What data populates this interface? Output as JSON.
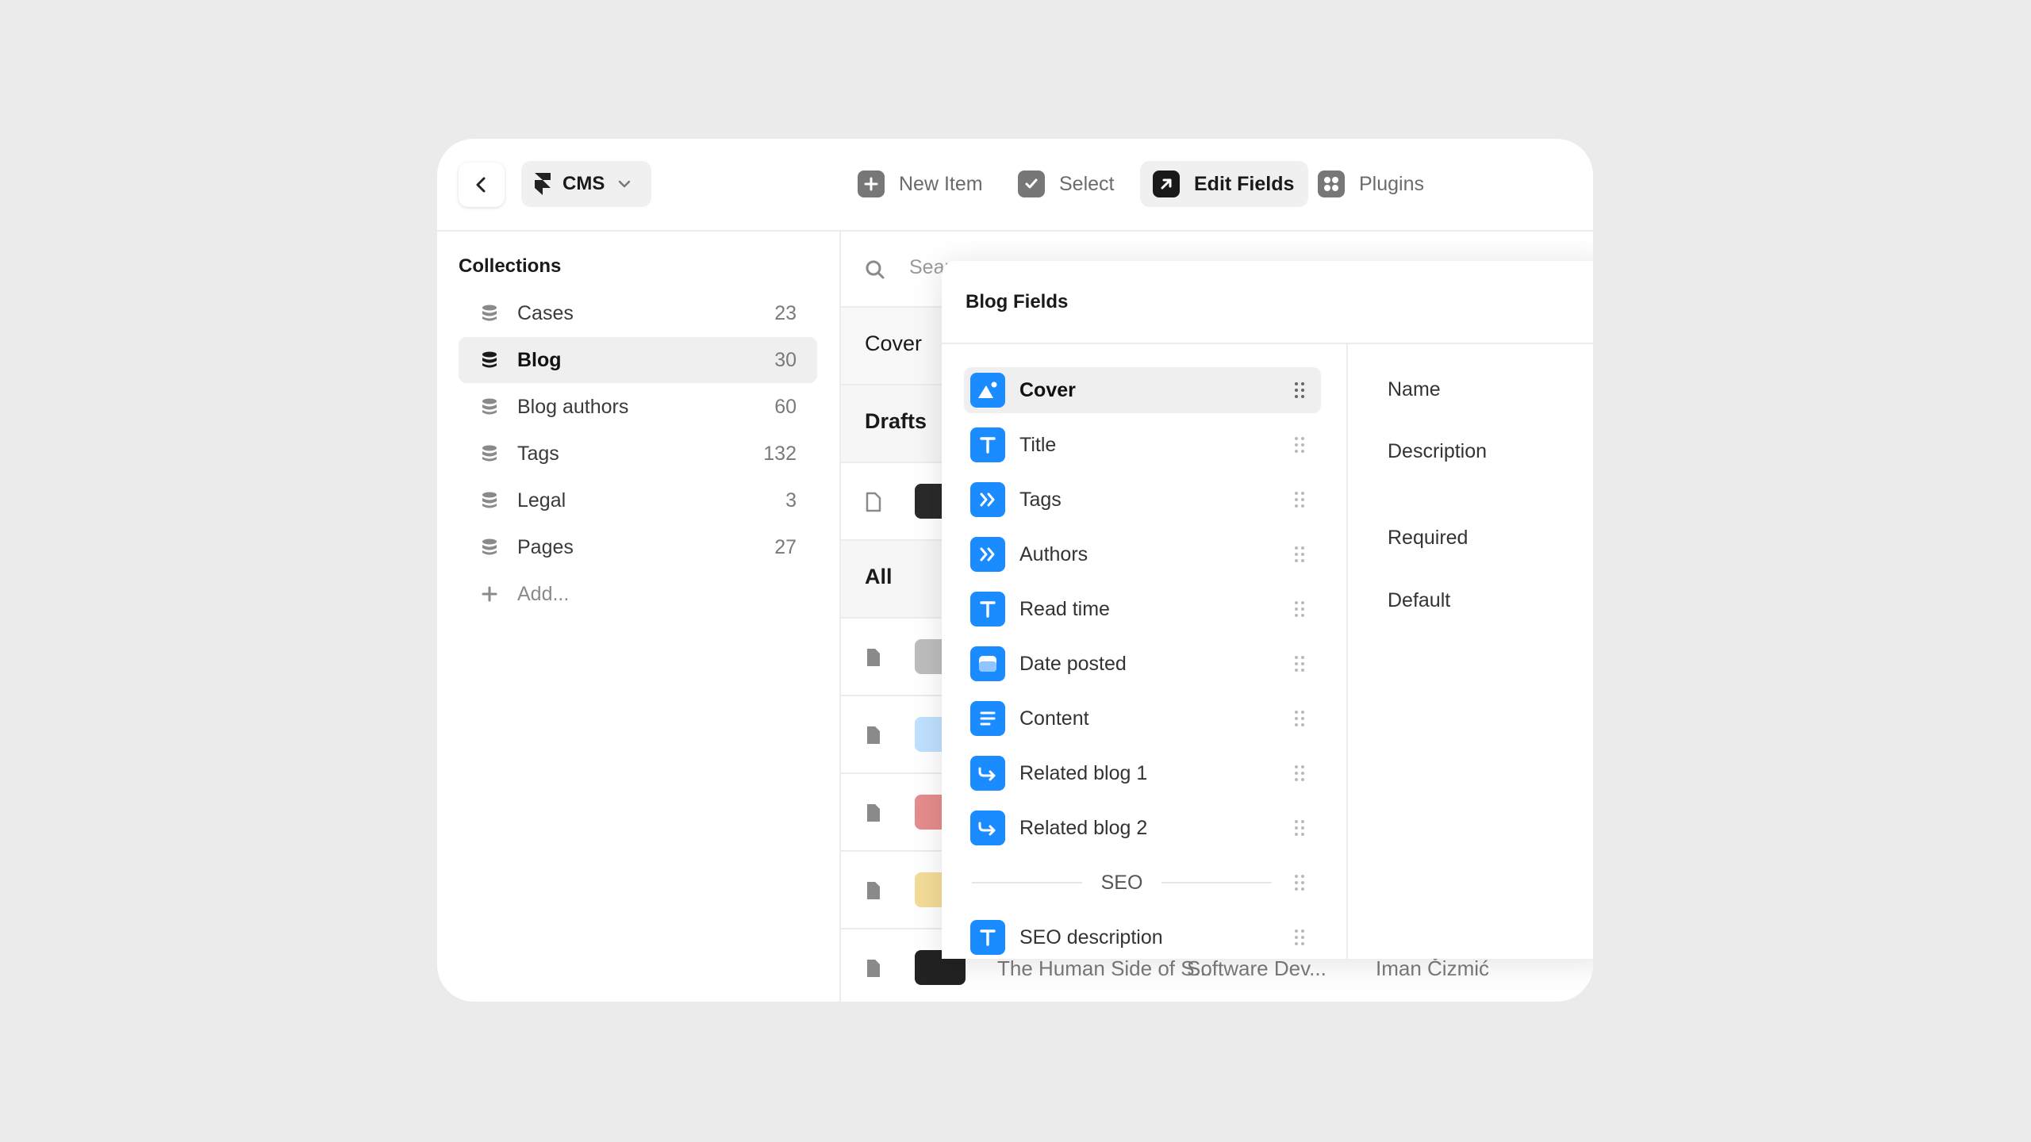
{
  "toolbar": {
    "app_label": "CMS",
    "new_item": "New Item",
    "select": "Select",
    "edit_fields": "Edit Fields",
    "plugins": "Plugins"
  },
  "sidebar": {
    "heading": "Collections",
    "items": [
      {
        "label": "Cases",
        "count": "23"
      },
      {
        "label": "Blog",
        "count": "30"
      },
      {
        "label": "Blog authors",
        "count": "60"
      },
      {
        "label": "Tags",
        "count": "132"
      },
      {
        "label": "Legal",
        "count": "3"
      },
      {
        "label": "Pages",
        "count": "27"
      }
    ],
    "add_label": "Add..."
  },
  "main": {
    "search_placeholder": "Sear",
    "cover_header": "Cover",
    "drafts_header": "Drafts",
    "all_header": "All",
    "last_row": {
      "title": "The Human Side of S...",
      "tag": "Software Dev...",
      "author": "Iman Čizmić"
    }
  },
  "modal": {
    "title": "Blog Fields",
    "fields": [
      {
        "label": "Cover",
        "icon": "image-icon"
      },
      {
        "label": "Title",
        "icon": "text-icon"
      },
      {
        "label": "Tags",
        "icon": "multi-reference-icon"
      },
      {
        "label": "Authors",
        "icon": "multi-reference-icon"
      },
      {
        "label": "Read time",
        "icon": "text-icon"
      },
      {
        "label": "Date posted",
        "icon": "date-icon"
      },
      {
        "label": "Content",
        "icon": "formatted-text-icon"
      },
      {
        "label": "Related blog 1",
        "icon": "reference-icon"
      },
      {
        "label": "Related blog 2",
        "icon": "reference-icon"
      }
    ],
    "divider_label": "SEO",
    "after_divider": [
      {
        "label": "SEO description",
        "icon": "text-icon"
      }
    ],
    "properties": {
      "name": "Name",
      "description": "Description",
      "required": "Required",
      "default": "Default"
    }
  },
  "colors": {
    "accent": "#1a8cff",
    "background": "#ebebeb",
    "panel": "#ffffff"
  }
}
